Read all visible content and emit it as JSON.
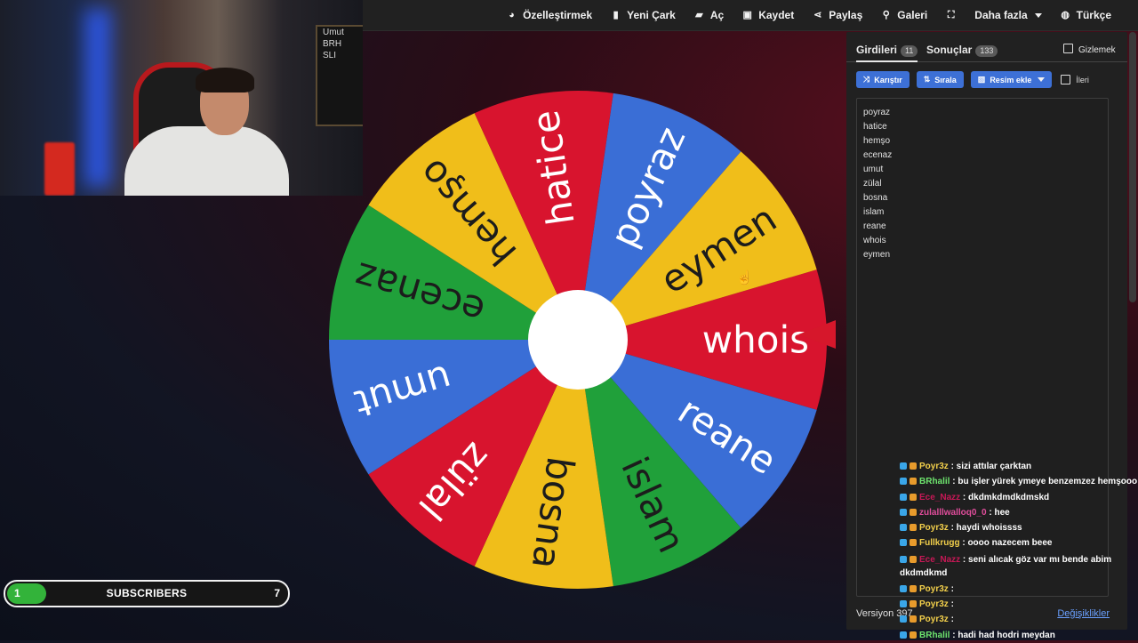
{
  "menu": [
    {
      "icon": "palette-icon",
      "glyph": "◕",
      "label": "Özelleştirmek"
    },
    {
      "icon": "file-icon",
      "glyph": "▮",
      "label": "Yeni Çark"
    },
    {
      "icon": "folder-open-icon",
      "glyph": "▰",
      "label": "Aç"
    },
    {
      "icon": "save-icon",
      "glyph": "▣",
      "label": "Kaydet"
    },
    {
      "icon": "share-icon",
      "glyph": "⋖",
      "label": "Paylaş"
    },
    {
      "icon": "search-icon",
      "glyph": "⚲",
      "label": "Galeri"
    },
    {
      "icon": "fullscreen-icon",
      "glyph": "⛶",
      "label": ""
    },
    {
      "icon": "more-caret-icon",
      "glyph": "",
      "label": "Daha fazla"
    },
    {
      "icon": "globe-icon",
      "glyph": "◍",
      "label": "Türkçe"
    }
  ],
  "webcam": {
    "board_lines": [
      "Umut",
      "BRH",
      "SLI"
    ]
  },
  "wheel": {
    "segments": [
      {
        "label": "whois",
        "color": "#d8142e"
      },
      {
        "label": "reane",
        "color": "#3a6ed6"
      },
      {
        "label": "islam",
        "color": "#20a03a"
      },
      {
        "label": "bosna",
        "color": "#f0be1a"
      },
      {
        "label": "zülal",
        "color": "#d8142e"
      },
      {
        "label": "umut",
        "color": "#3a6ed6"
      },
      {
        "label": "ecenaz",
        "color": "#20a03a"
      },
      {
        "label": "hemşo",
        "color": "#f0be1a"
      },
      {
        "label": "hatice",
        "color": "#d8142e"
      },
      {
        "label": "poyraz",
        "color": "#3a6ed6"
      },
      {
        "label": "eymen",
        "color": "#f0be1a"
      }
    ]
  },
  "panel": {
    "tab_entries": "Girdileri",
    "entries_count": "11",
    "tab_results": "Sonuçlar",
    "results_count": "133",
    "hide_label": "Gizlemek",
    "shuffle": "Karıştır",
    "sort": "Sırala",
    "add_image": "Resim ekle",
    "advanced": "İleri",
    "entries": [
      "poyraz",
      "hatice",
      "hemşo",
      "ecenaz",
      "umut",
      "zülal",
      "bosna",
      "islam",
      "reane",
      "whois",
      "eymen"
    ],
    "version": "Versiyon 397",
    "changes": "Değişiklikler"
  },
  "chat": [
    {
      "user": "Poyr3z",
      "cls": "u1",
      "text": " : sizi attılar çarktan"
    },
    {
      "user": "BRhalil",
      "cls": "u2",
      "text": " : bu işler yürek ymeye benzemzez hemşooo"
    },
    {
      "user": "Ece_Nazz",
      "cls": "u3",
      "text": " : dkdmkdmdkdmskd"
    },
    {
      "user": "zulalllwalloq0_0",
      "cls": "u4",
      "text": " : hee"
    },
    {
      "user": "Poyr3z",
      "cls": "u1",
      "text": " : haydi whoissss"
    },
    {
      "user": "Fullkrugg",
      "cls": "u5",
      "text": " : oooo nazecem beee"
    },
    {
      "user": "Ece_Nazz",
      "cls": "u3",
      "text": " : seni alıcak göz var mı bende abim dkdmdkmd",
      "wrap": true
    },
    {
      "user": "Poyr3z",
      "cls": "u1",
      "text": " : "
    },
    {
      "user": "Poyr3z",
      "cls": "u1",
      "text": " : "
    },
    {
      "user": "Poyr3z",
      "cls": "u1",
      "text": " : "
    },
    {
      "user": "BRhalil",
      "cls": "u2",
      "text": " : hadi had hodri meydan"
    }
  ],
  "subscribers": {
    "label": "SUBSCRIBERS",
    "current": "1",
    "goal": "7",
    "progress_fraction": 0.14
  }
}
